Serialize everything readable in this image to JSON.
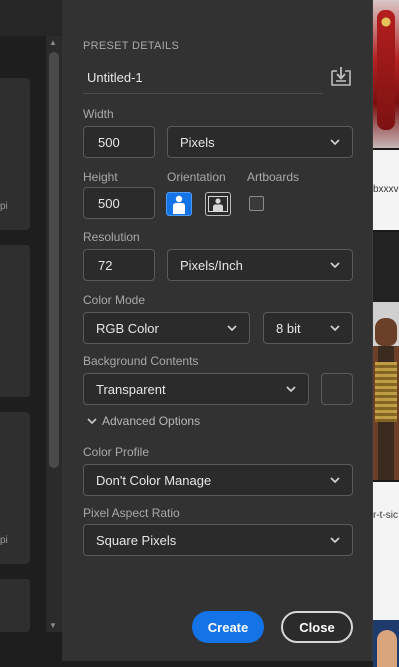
{
  "preset_details": {
    "section_title": "PRESET DETAILS",
    "name": "Untitled-1",
    "save_icon": "save-preset-icon"
  },
  "width": {
    "label": "Width",
    "value": "500",
    "unit": "Pixels"
  },
  "height": {
    "label": "Height",
    "value": "500"
  },
  "orientation": {
    "label": "Orientation",
    "selected": "portrait"
  },
  "artboards": {
    "label": "Artboards",
    "checked": false
  },
  "resolution": {
    "label": "Resolution",
    "value": "72",
    "unit": "Pixels/Inch"
  },
  "color_mode": {
    "label": "Color Mode",
    "mode": "RGB Color",
    "bits": "8 bit"
  },
  "background_contents": {
    "label": "Background Contents",
    "value": "Transparent"
  },
  "advanced_options": {
    "label": "Advanced Options"
  },
  "color_profile": {
    "label": "Color Profile",
    "value": "Don't Color Manage"
  },
  "pixel_aspect_ratio": {
    "label": "Pixel Aspect Ratio",
    "value": "Square Pixels"
  },
  "buttons": {
    "create": "Create",
    "close": "Close"
  },
  "background": {
    "left_fragments": [
      "pi",
      "pi"
    ],
    "right_fragments": [
      "bxxxv",
      "r-t-sic"
    ]
  },
  "colors": {
    "accent": "#1473e6",
    "dialog_bg": "#323232"
  }
}
